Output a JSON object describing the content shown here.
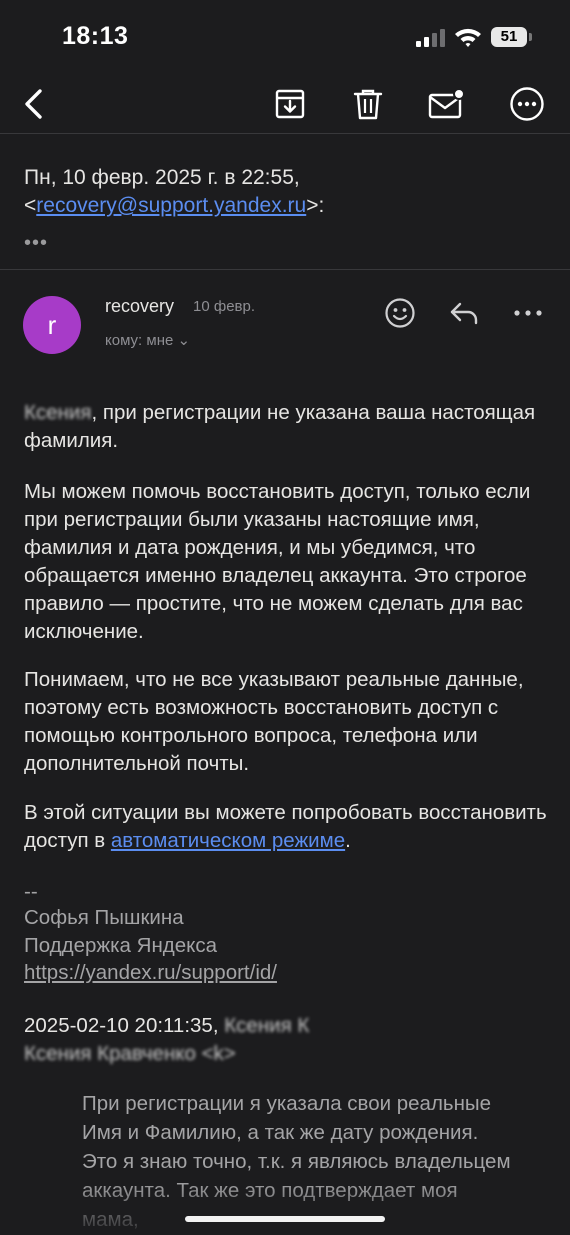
{
  "status_bar": {
    "time": "18:13",
    "battery": "51"
  },
  "toolbar": {
    "icons": [
      "back-icon",
      "archive-icon",
      "trash-icon",
      "mark-unread-icon",
      "more-icon"
    ]
  },
  "header": {
    "date_line": "Пн, 10 февр. 2025 г. в 22:55,",
    "email_prefix": "<",
    "email": "recovery@support.yandex.ru",
    "email_suffix": ">:",
    "more": "•••"
  },
  "message": {
    "avatar_letter": "r",
    "sender": "recovery",
    "date": "10 февр.",
    "to": "кому: мне ⌄",
    "paragraphs": [
      {
        "greeting": "Ксения",
        "text": ", при регистрации не указана ваша настоящая фамилия."
      },
      {
        "text": "Мы можем помочь восстановить доступ, только если при регистрации были указаны настоящие имя, фамилия и дата рождения, и мы убедимся, что обращается именно владелец аккаунта. Это строгое правило — простите, что не можем сделать для вас исключение."
      },
      {
        "text": "Понимаем, что не все указывают реальные данные, поэтому есть возможность восстановить доступ с помощью контрольного вопроса, телефона или дополнительной почты."
      }
    ],
    "last_paragraph_prefix": "В этой ситуации вы можете попробовать восстановить доступ в ",
    "auto_link": "автоматическом режиме",
    "last_paragraph_suffix": ".",
    "signature": {
      "dashes": "--",
      "name": "Софья Пышкина",
      "team": "Поддержка Яндекса",
      "link": "https://yandex.ru/support/id/"
    },
    "quoted_header_date": "2025-02-10 20:11:35,",
    "quoted_header_blurred_1": "Ксения К",
    "quoted_header_blurred_2": "Ксения Кравченко <k>",
    "quoted_text": "При регистрации я указала свои реальные Имя и Фамилию, а так же дату рождения. Это я знаю точно, т.к. я являюсь владельцем аккаунта. Так же это подтверждает моя мама,"
  }
}
